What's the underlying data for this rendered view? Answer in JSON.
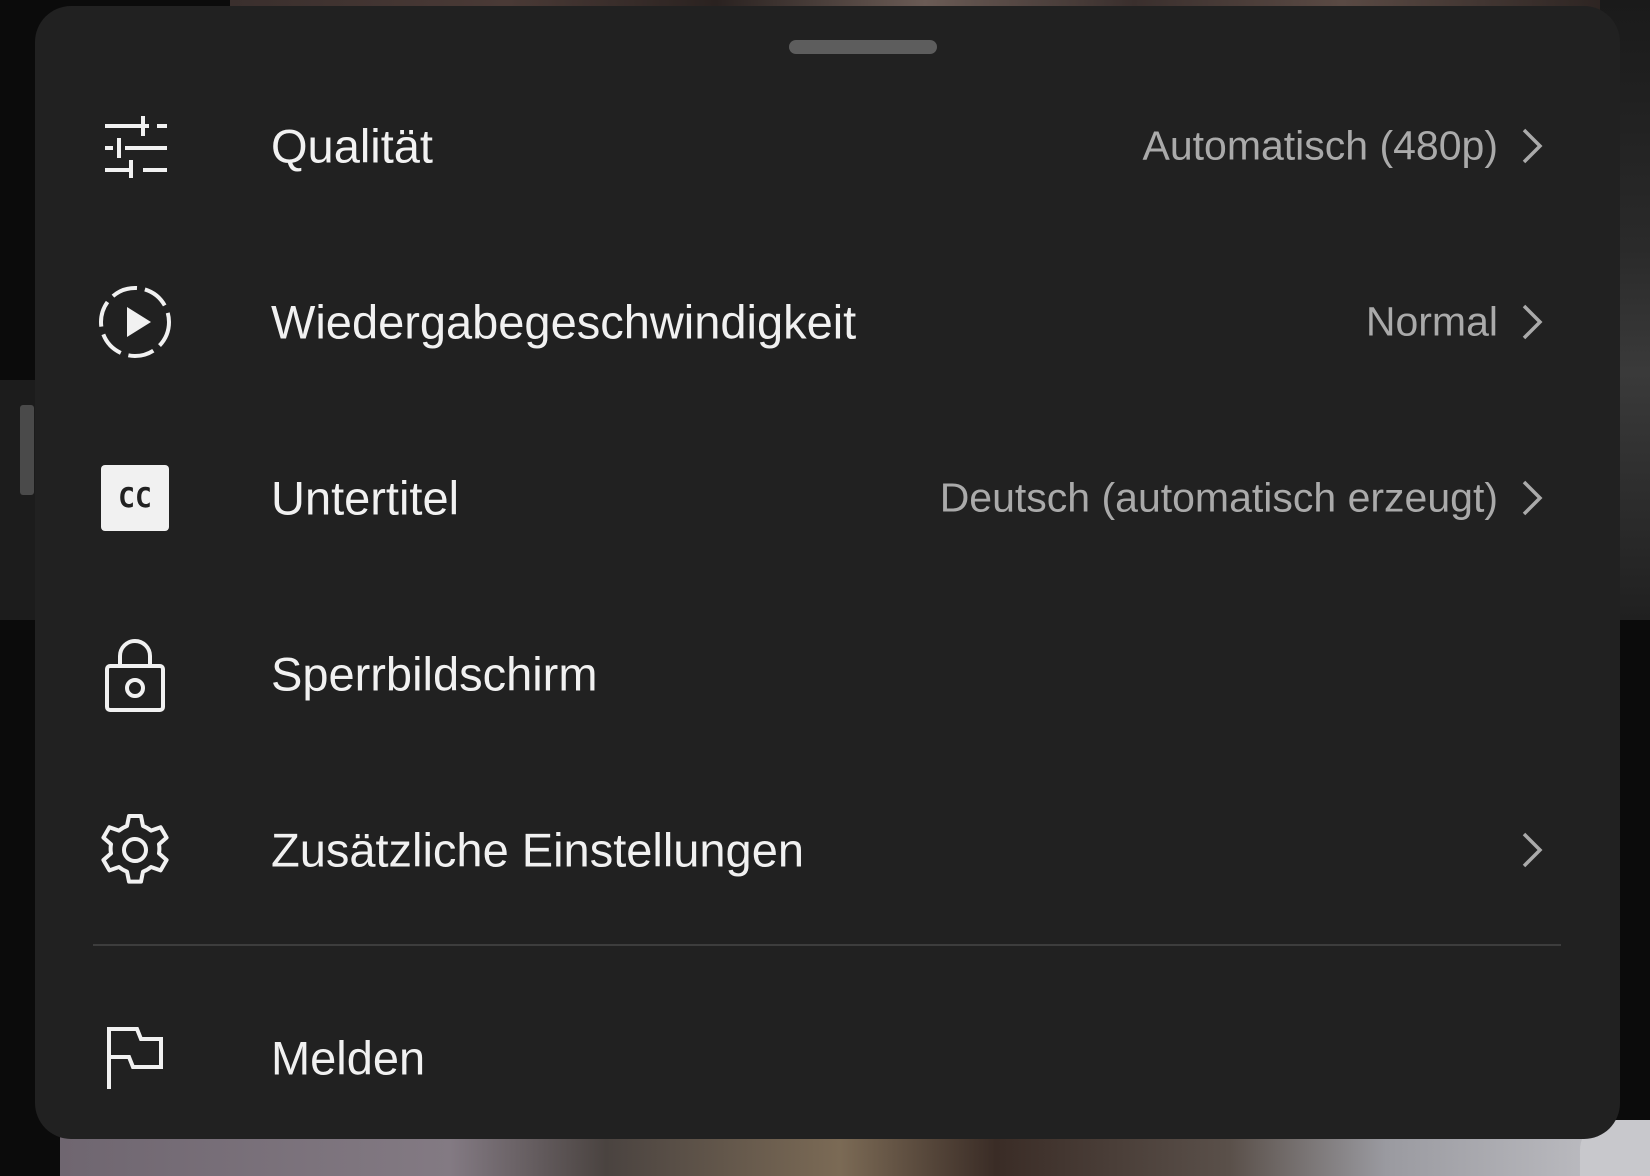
{
  "menu": {
    "items": [
      {
        "label": "Qualität",
        "value": "Automatisch (480p)",
        "icon": "sliders-icon",
        "has_chevron": true
      },
      {
        "label": "Wiedergabegeschwindigkeit",
        "value": "Normal",
        "icon": "playback-speed-icon",
        "has_chevron": true
      },
      {
        "label": "Untertitel",
        "value": "Deutsch (automatisch erzeugt)",
        "icon": "closed-captions-icon",
        "icon_text": "CC",
        "has_chevron": true
      },
      {
        "label": "Sperrbildschirm",
        "icon": "lock-icon",
        "has_chevron": false
      },
      {
        "label": "Zusätzliche Einstellungen",
        "icon": "gear-icon",
        "has_chevron": true
      },
      {
        "label": "Melden",
        "icon": "flag-icon",
        "has_chevron": false
      }
    ]
  },
  "colors": {
    "sheet_background": "#212121",
    "label_text": "#f1f1f1",
    "value_text": "#aaaaaa",
    "handle": "#5d5d5d",
    "divider": "#3d3d3d"
  }
}
